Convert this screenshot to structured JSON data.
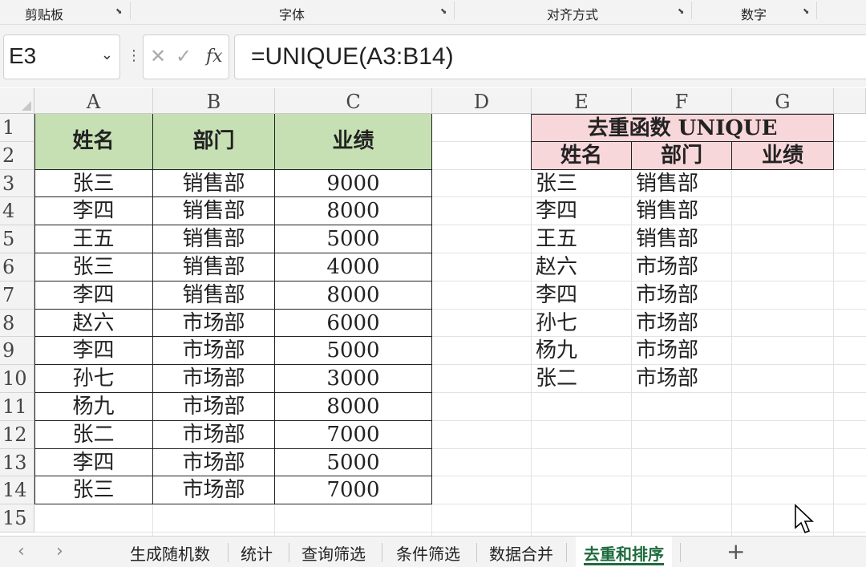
{
  "ribbon": {
    "groups": [
      {
        "label": "剪贴板"
      },
      {
        "label": "字体"
      },
      {
        "label": "对齐方式"
      },
      {
        "label": "数字"
      }
    ]
  },
  "formula_bar": {
    "name_box": "E3",
    "formula": "=UNIQUE(A3:B14)"
  },
  "grid": {
    "columns": [
      "A",
      "B",
      "C",
      "D",
      "E",
      "F",
      "G"
    ],
    "rows": [
      "1",
      "2",
      "3",
      "4",
      "5",
      "6",
      "7",
      "8",
      "9",
      "10",
      "11",
      "12",
      "13",
      "14",
      "15"
    ],
    "left_table": {
      "headers": [
        "姓名",
        "部门",
        "业绩"
      ],
      "rows": [
        [
          "张三",
          "销售部",
          "9000"
        ],
        [
          "李四",
          "销售部",
          "8000"
        ],
        [
          "王五",
          "销售部",
          "5000"
        ],
        [
          "张三",
          "销售部",
          "4000"
        ],
        [
          "李四",
          "销售部",
          "8000"
        ],
        [
          "赵六",
          "市场部",
          "6000"
        ],
        [
          "李四",
          "市场部",
          "5000"
        ],
        [
          "孙七",
          "市场部",
          "3000"
        ],
        [
          "杨九",
          "市场部",
          "8000"
        ],
        [
          "张二",
          "市场部",
          "7000"
        ],
        [
          "李四",
          "市场部",
          "5000"
        ],
        [
          "张三",
          "市场部",
          "7000"
        ]
      ],
      "header_color": "#c6e0b4"
    },
    "right_table": {
      "title": "去重函数 UNIQUE",
      "headers": [
        "姓名",
        "部门",
        "业绩"
      ],
      "rows": [
        [
          "张三",
          "销售部"
        ],
        [
          "李四",
          "销售部"
        ],
        [
          "王五",
          "销售部"
        ],
        [
          "赵六",
          "市场部"
        ],
        [
          "李四",
          "市场部"
        ],
        [
          "孙七",
          "市场部"
        ],
        [
          "杨九",
          "市场部"
        ],
        [
          "张二",
          "市场部"
        ]
      ],
      "header_color": "#f8d7da"
    }
  },
  "sheet_tabs": {
    "tabs": [
      "生成随机数",
      "统计",
      "查询筛选",
      "条件筛选",
      "数据合并",
      "去重和排序"
    ],
    "active": "去重和排序",
    "add_label": "+"
  }
}
